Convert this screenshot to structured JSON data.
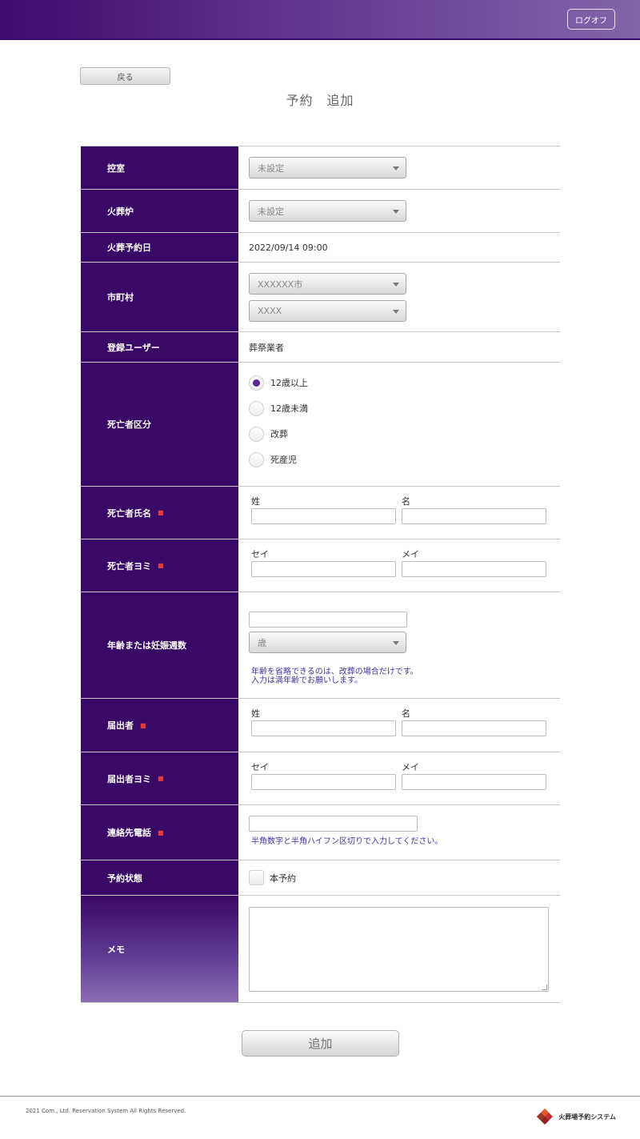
{
  "header": {
    "logoff_label": "ログオフ"
  },
  "toolbar": {
    "back_label": "戻る"
  },
  "page": {
    "title": "予約　追加"
  },
  "form": {
    "waiting_room": {
      "label": "控室",
      "value": "未設定"
    },
    "furnace": {
      "label": "火葬炉",
      "value": "未設定"
    },
    "date": {
      "label": "火葬予約日",
      "value": "2022/09/14 09:00"
    },
    "municipality": {
      "label": "市町村",
      "city": "XXXXXX市",
      "area": "XXXX"
    },
    "user": {
      "label": "登録ユーザー",
      "value": "葬祭業者"
    },
    "category": {
      "label": "死亡者区分",
      "options": [
        "12歳以上",
        "12歳未満",
        "改葬",
        "死産児"
      ],
      "selected": "12歳以上"
    },
    "deceased_name": {
      "label": "死亡者氏名",
      "last": "姓",
      "first": "名"
    },
    "deceased_kana": {
      "label": "死亡者ヨミ",
      "last": "セイ",
      "first": "メイ"
    },
    "age": {
      "label": "年齢または妊娠週数",
      "unit": "歳",
      "note1": "年齢を省略できるのは、改葬の場合だけです。",
      "note2": "入力は満年齢でお願いします。"
    },
    "applicant": {
      "label": "届出者",
      "last": "姓",
      "first": "名"
    },
    "applicant_kana": {
      "label": "届出者ヨミ",
      "last": "セイ",
      "first": "メイ"
    },
    "phone": {
      "label": "連絡先電話",
      "note": "半角数字と半角ハイフン区切りで入力してください。"
    },
    "status": {
      "label": "予約状態",
      "checkbox_label": "本予約"
    },
    "memo": {
      "label": "メモ"
    },
    "required_mark": "■"
  },
  "actions": {
    "add_label": "追加"
  },
  "footer": {
    "copyright": "2021 Com., Ltd. Reservation System All Rights Reserved.",
    "brand": "火葬場予約システム"
  },
  "colors": {
    "accent": "#3a0867",
    "note": "#3f34a0",
    "required": "#e23b3b"
  }
}
